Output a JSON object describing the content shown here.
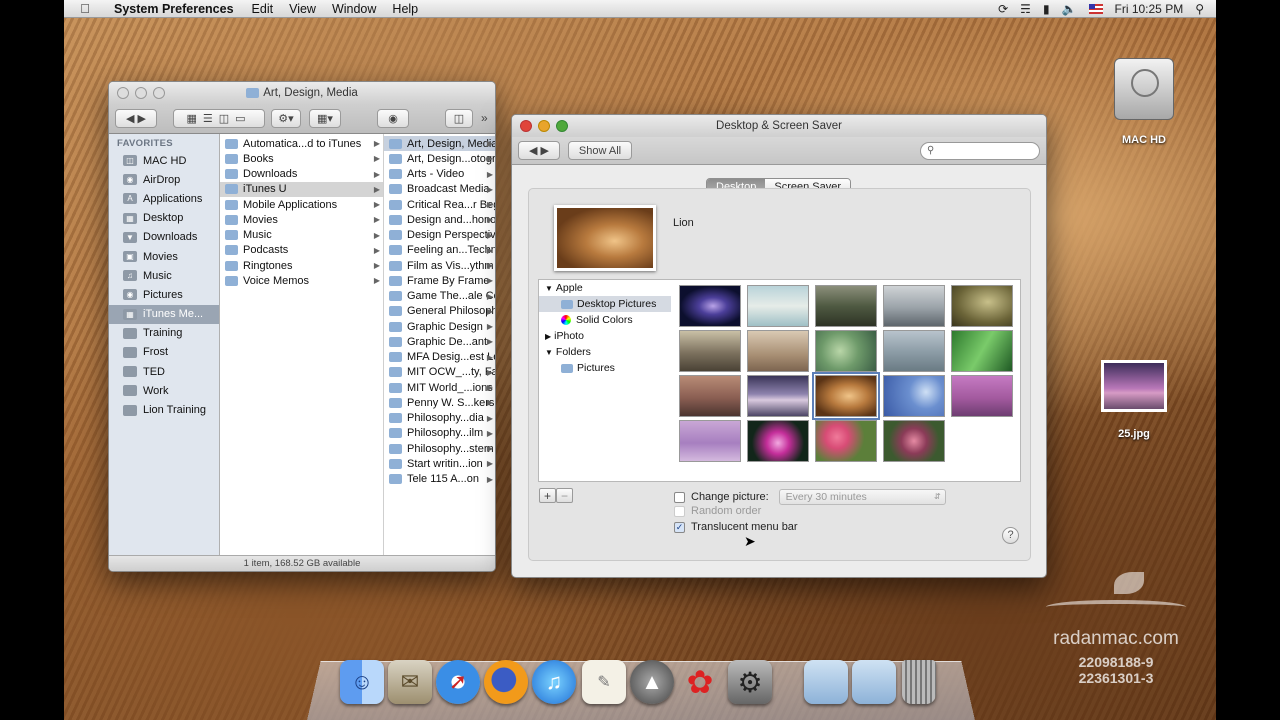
{
  "menubar": {
    "app_name": "System Preferences",
    "menus": [
      "Edit",
      "View",
      "Window",
      "Help"
    ],
    "clock": "Fri 10:25 PM"
  },
  "desktop": {
    "hd_label": "MAC HD",
    "file_label": "25.jpg"
  },
  "finder": {
    "title": "Art, Design, Media",
    "sidebar_header": "FAVORITES",
    "sidebar_items": [
      "MAC HD",
      "AirDrop",
      "Applications",
      "Desktop",
      "Downloads",
      "Movies",
      "Music",
      "Pictures",
      "iTunes Me...",
      "Training",
      "Frost",
      "TED",
      "Work",
      "Lion Training"
    ],
    "col2": [
      "Automatica...d to iTunes",
      "Books",
      "Downloads",
      "iTunes U",
      "Mobile Applications",
      "Movies",
      "Music",
      "Podcasts",
      "Ringtones",
      "Voice Memos"
    ],
    "col3": [
      "Art, Design, Media",
      "Art, Design...otography",
      "Arts - Video",
      "Broadcast Media",
      "Critical Rea...r Beginners",
      "Design and...honology",
      "Design Perspectives",
      "Feeling an...Technology",
      "Film as Vis...ythm",
      "Frame By Frame",
      "Game The...ale Course",
      "General Philosophy",
      "Graphic Design",
      "Graphic De...ant",
      "MFA Desig...est Lecture",
      "MIT OCW_...ty, Fall",
      "MIT World_...ions",
      "Penny W. S...kers",
      "Philosophy...dia",
      "Philosophy...ilm",
      "Philosophy...stern",
      "Start writin...ion",
      "Tele 115 A...on"
    ],
    "status": "1 item, 168.52 GB available"
  },
  "prefs": {
    "title": "Desktop & Screen Saver",
    "show_all": "Show All",
    "tabs": [
      "Desktop",
      "Screen Saver"
    ],
    "current_name": "Lion",
    "source": {
      "apple": "Apple",
      "desktop_pictures": "Desktop Pictures",
      "solid_colors": "Solid Colors",
      "iphoto": "iPhoto",
      "folders": "Folders",
      "pictures": "Pictures"
    },
    "change_picture": "Change picture:",
    "interval": "Every 30 minutes",
    "random_order": "Random order",
    "translucent": "Translucent menu bar",
    "add": "+",
    "remove": "−",
    "help": "?"
  },
  "watermark": {
    "site": "radanmac.com",
    "line1": "22098188-9",
    "line2": "22361301-3"
  },
  "colors": {
    "selection": "#5c7fb8"
  }
}
